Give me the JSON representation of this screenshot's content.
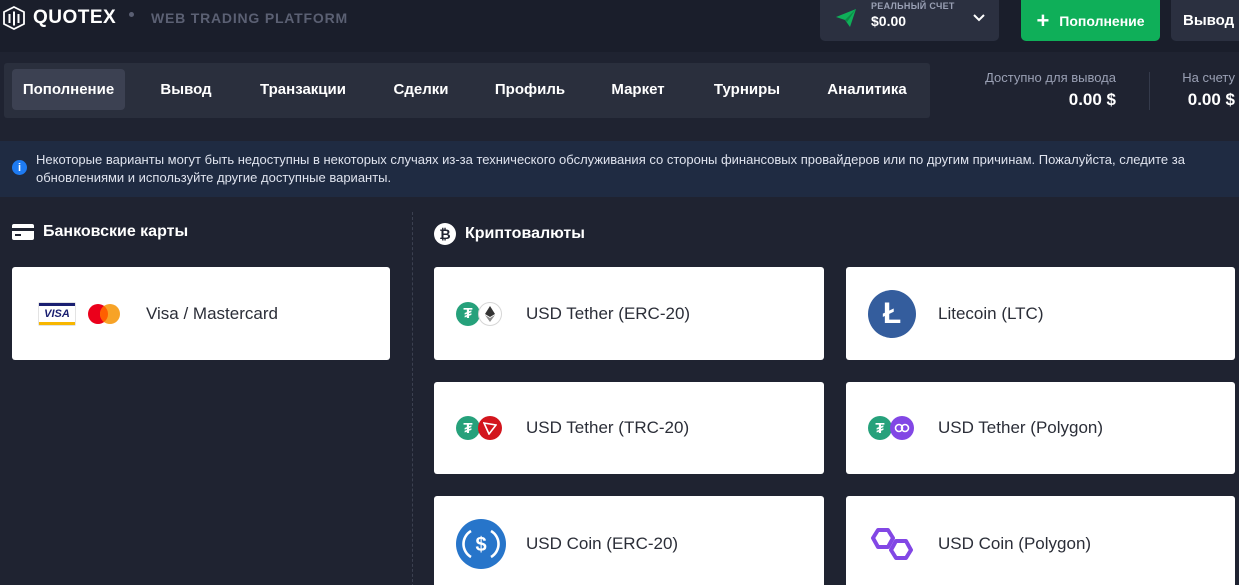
{
  "header": {
    "logo_text": "QUOTEX",
    "platform_label": "WEB TRADING PLATFORM",
    "account": {
      "label": "РЕАЛЬНЫЙ СЧЕТ",
      "balance": "$0.00",
      "icon": "paper-plane-icon"
    },
    "deposit_button": "Пополнение",
    "withdraw_button": "Вывод"
  },
  "tabs": [
    {
      "label": "Пополнение",
      "active": true
    },
    {
      "label": "Вывод",
      "active": false
    },
    {
      "label": "Транзакции",
      "active": false
    },
    {
      "label": "Сделки",
      "active": false
    },
    {
      "label": "Профиль",
      "active": false
    },
    {
      "label": "Маркет",
      "active": false
    },
    {
      "label": "Турниры",
      "active": false
    },
    {
      "label": "Аналитика",
      "active": false
    }
  ],
  "balances": {
    "available_label": "Доступно для вывода",
    "available_value": "0.00 $",
    "account_label": "На счету",
    "account_value": "0.00 $"
  },
  "notice": {
    "text": "Некоторые варианты могут быть недоступны в некоторых случаях из-за технического обслуживания со стороны финансовых провайдеров или по другим причинам. Пожалуйста, следите за обновлениями и используйте другие доступные варианты."
  },
  "sections": {
    "bank_cards": {
      "title": "Банковские карты",
      "items": [
        {
          "name": "Visa / Mastercard",
          "visa_text": "VISA"
        }
      ]
    },
    "crypto": {
      "title": "Криптовалюты",
      "items": [
        {
          "name": "USD Tether (ERC-20)"
        },
        {
          "name": "Litecoin (LTC)"
        },
        {
          "name": "USD Tether (TRC-20)"
        },
        {
          "name": "USD Tether (Polygon)"
        },
        {
          "name": "USD Coin (ERC-20)"
        },
        {
          "name": "USD Coin (Polygon)"
        }
      ]
    }
  },
  "colors": {
    "background": "#1f2331",
    "header": "#1a1e2b",
    "accent_green": "#0faf59",
    "notice_bg": "#1f2b42",
    "tether": "#26a17b",
    "tron": "#d3151d",
    "polygon": "#8247e5",
    "litecoin": "#345d9d",
    "usdc": "#2775ca"
  }
}
